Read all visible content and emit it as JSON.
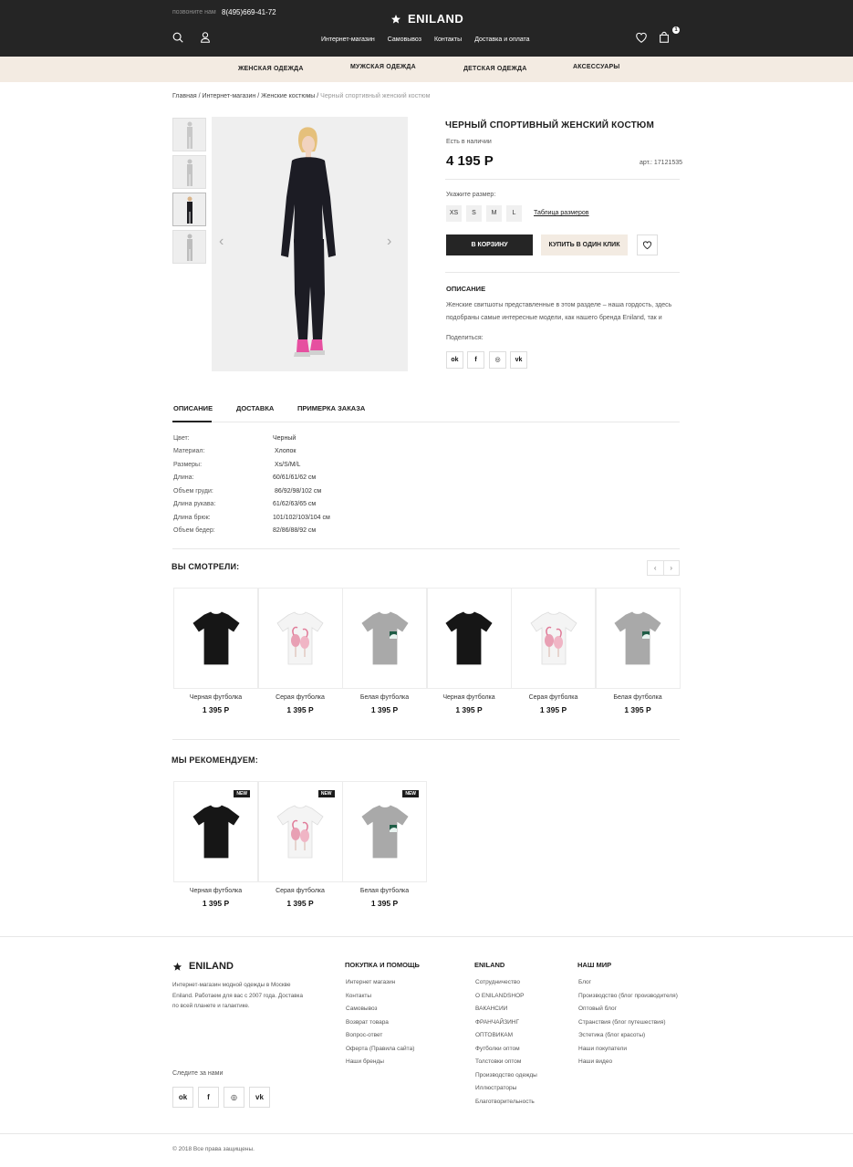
{
  "header": {
    "call_label": "позвоните нам",
    "phone": "8(495)669-41-72",
    "brand": "ENILAND",
    "nav": [
      "Интернет-магазин",
      "Самовывоз",
      "Контакты",
      "Доставка и оплата"
    ],
    "cart_count": "1",
    "icons": [
      "search-icon",
      "user-icon",
      "heart-icon",
      "bag-icon"
    ]
  },
  "categories": [
    "ЖЕНСКАЯ ОДЕЖДА",
    "МУЖСКАЯ ОДЕЖДА",
    "ДЕТСКАЯ ОДЕЖДА",
    "АКСЕССУАРЫ"
  ],
  "breadcrumb": {
    "items": [
      "Главная",
      "Интернет-магазин",
      "Женские костюмы"
    ],
    "current": "Черный спортивный женский костюм"
  },
  "product": {
    "title": "ЧЕРНЫЙ СПОРТИВНЫЙ ЖЕНСКИЙ КОСТЮМ",
    "stock": "Есть в наличии",
    "price": "4 195 Р",
    "sku": "арт.: 17121535",
    "size_label": "Укажите размер:",
    "sizes": [
      "XS",
      "S",
      "M",
      "L"
    ],
    "size_table": "Таблица размеров",
    "btn_cart": "В КОРЗИНУ",
    "btn_one_click": "КУПИТЬ В ОДИН КЛИК",
    "desc_title": "ОПИСАНИЕ",
    "desc_text": "Женские свитшоты представленные в этом разделе – наша гордость, здесь подобраны самые интересные модели, как нашего бренда Eniland, так и",
    "share_label": "Поделиться:",
    "share": [
      "ok",
      "f",
      "ig",
      "vk"
    ]
  },
  "tabs": [
    "ОПИСАНИЕ",
    "ДОСТАВКА",
    "ПРИМЕРКА ЗАКАЗА"
  ],
  "specs": [
    {
      "k": "Цвет:",
      "v": "Черный"
    },
    {
      "k": "Материал:",
      "v": "Хлопок"
    },
    {
      "k": "Размеры:",
      "v": "Xs/S/M/L"
    },
    {
      "k": "Длина:",
      "v": "60/61/61/62 см"
    },
    {
      "k": "Объем груди:",
      "v": "86/92/98/102 см"
    },
    {
      "k": "Длина рукава:",
      "v": "61/62/63/65 см"
    },
    {
      "k": "Длина брюк:",
      "v": "101/102/103/104 см"
    },
    {
      "k": "Объем бедер:",
      "v": "82/86/88/92 см"
    }
  ],
  "viewed": {
    "title": "ВЫ СМОТРЕЛИ:",
    "items": [
      {
        "name": "Черная футболка",
        "price": "1 395 Р",
        "img": "black"
      },
      {
        "name": "Серая футболка",
        "price": "1 395 Р",
        "img": "flamingo"
      },
      {
        "name": "Белая футболка",
        "price": "1 395 Р",
        "img": "grey"
      },
      {
        "name": "Черная футболка",
        "price": "1 395 Р",
        "img": "black"
      },
      {
        "name": "Серая футболка",
        "price": "1 395 Р",
        "img": "flamingo"
      },
      {
        "name": "Белая футболка",
        "price": "1 395 Р",
        "img": "grey"
      }
    ]
  },
  "recommend": {
    "title": "МЫ РЕКОМЕНДУЕМ:",
    "badge": "NEW",
    "items": [
      {
        "name": "Черная футболка",
        "price": "1 395 Р",
        "img": "black"
      },
      {
        "name": "Серая футболка",
        "price": "1 395 Р",
        "img": "flamingo"
      },
      {
        "name": "Белая футболка",
        "price": "1 395 Р",
        "img": "grey"
      }
    ]
  },
  "footer": {
    "brand": "ENILAND",
    "about": "Интернет-магазин модной одежды в Москве Eniland. Работаем для вас с 2007 года. Доставка по всей планете и галактике.",
    "follow": "Следите за нами",
    "cols": [
      {
        "title": "ПОКУПКА И ПОМОЩЬ",
        "links": [
          "Интернет магазин",
          "Контакты",
          "Самовывоз",
          "Возврат товара",
          "Вопрос-ответ",
          "Оферта (Правила сайта)",
          "Наши бренды"
        ]
      },
      {
        "title": "ENILAND",
        "links": [
          "Сотрудничество",
          "О ENILANDSHOP",
          "ВАКАНСИИ",
          "ФРАНЧАЙЗИНГ",
          "ОПТОВИКАМ",
          "Футболки оптом",
          "Толстовки оптом",
          "Производство одежды",
          "Иллюстраторы",
          "Благотворительность"
        ]
      },
      {
        "title": "НАШ МИР",
        "links": [
          "Блог",
          "Производство (блог производителя)",
          "Оптовый блог",
          "Странствия (блог путешествия)",
          "Эстетика (блог красоты)",
          "Наши покупатели",
          "Наши видео"
        ]
      }
    ],
    "copyright": "© 2018 Все права защищены."
  }
}
